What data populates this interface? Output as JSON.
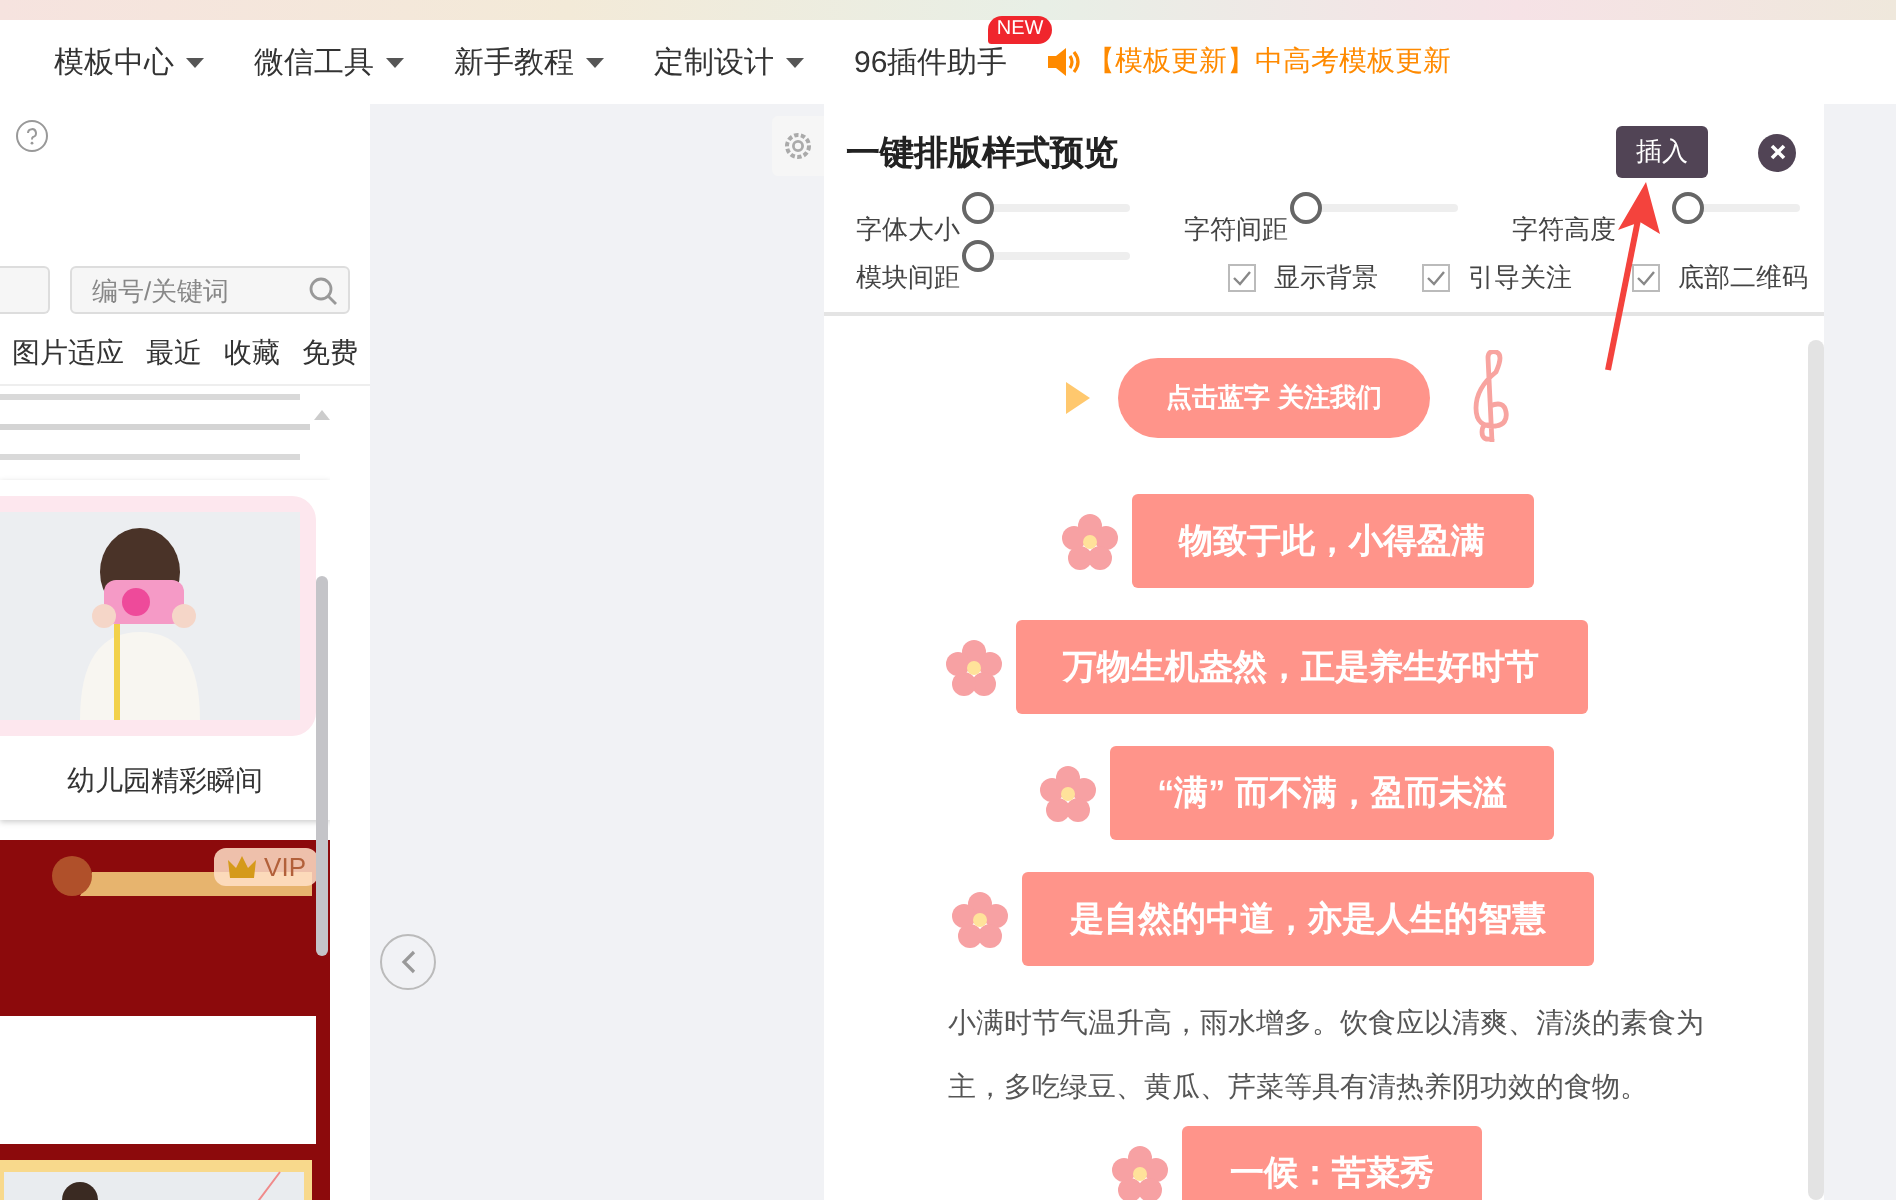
{
  "top_nav": {
    "items": [
      {
        "label": "模板中心",
        "dropdown": true
      },
      {
        "label": "微信工具",
        "dropdown": true
      },
      {
        "label": "新手教程",
        "dropdown": true
      },
      {
        "label": "定制设计",
        "dropdown": true
      },
      {
        "label": "96插件助手",
        "dropdown": false,
        "badge": "NEW"
      }
    ],
    "notice": "【模板更新】中高考模板更新"
  },
  "sidebar": {
    "search": {
      "placeholder": "编号/关键词"
    },
    "filters": [
      {
        "label": "图片适应"
      },
      {
        "label": "最近"
      },
      {
        "label": "收藏"
      },
      {
        "label": "免费"
      }
    ],
    "cards": [
      {
        "kind": "text"
      },
      {
        "caption": "幼儿园精彩瞬间"
      },
      {
        "kind": "vip",
        "badge": "VIP"
      }
    ]
  },
  "preview": {
    "title": "一键排版样式预览",
    "insert_button": "插入",
    "sliders": [
      {
        "label": "字体大小",
        "level": 0
      },
      {
        "label": "字符间距",
        "level": 0
      },
      {
        "label": "字符高度",
        "level": 0.1
      },
      {
        "label": "模块间距",
        "level": 0
      }
    ],
    "options": [
      {
        "label": "显示背景",
        "checked": true
      },
      {
        "label": "引导关注",
        "checked": true
      },
      {
        "label": "底部二维码",
        "checked": true
      }
    ],
    "content": [
      {
        "kind": "follow",
        "text": "点击蓝字 关注我们"
      },
      {
        "kind": "heading",
        "text": "物致于此，小得盈满"
      },
      {
        "kind": "heading",
        "text": "万物生机盎然，正是养生好时节"
      },
      {
        "kind": "heading",
        "text": "“满” 而不满，盈而未溢"
      },
      {
        "kind": "heading",
        "text": "是自然的中道，亦是人生的智慧"
      },
      {
        "kind": "paragraph",
        "text": "小满时节气温升高，雨水增多。饮食应以清爽、清淡的素食为主，多吃绿豆、黄瓜、芹菜等具有清热养阴功效的食物。"
      },
      {
        "kind": "heading",
        "text": "一候：苦菜秀"
      }
    ]
  }
}
